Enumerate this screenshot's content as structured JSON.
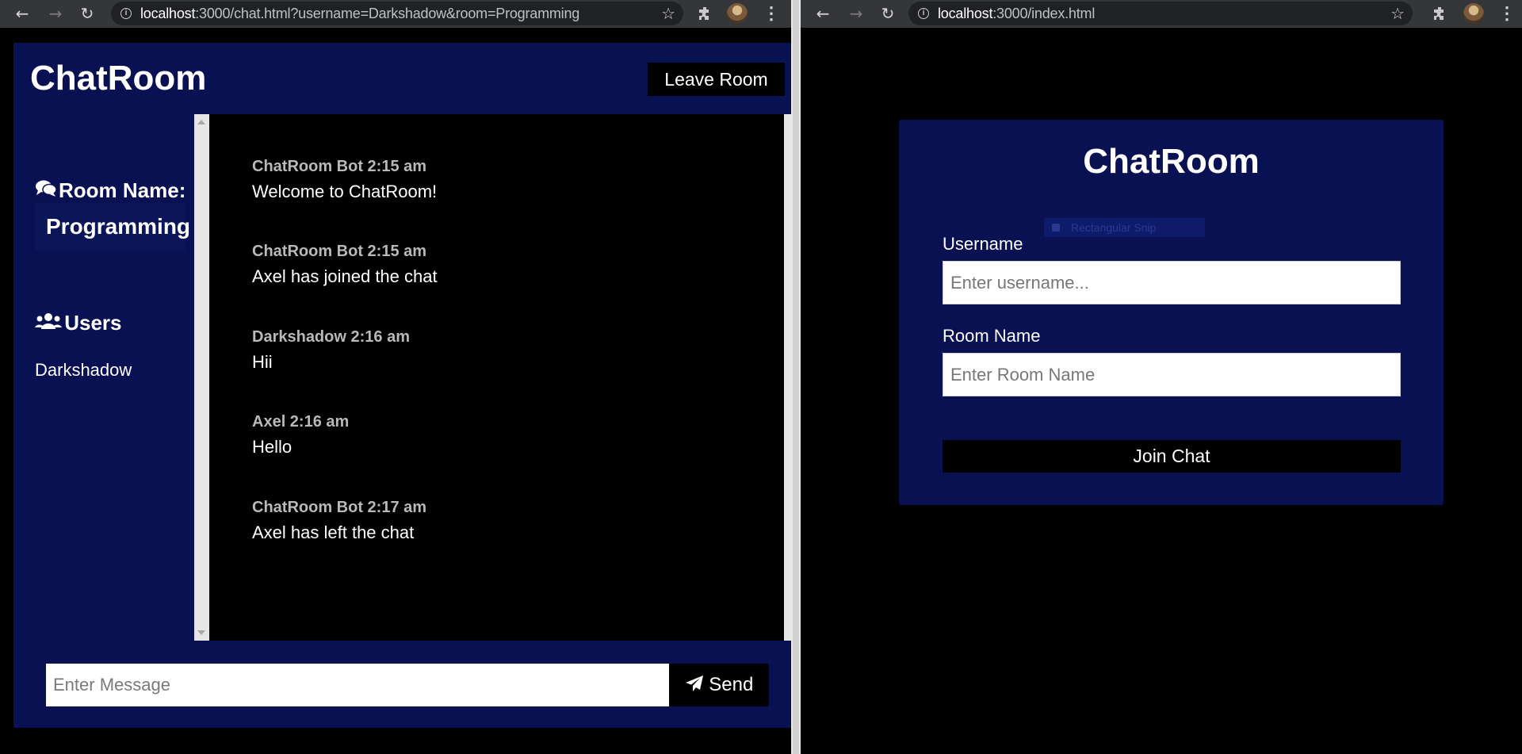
{
  "left_window": {
    "url_host": "localhost",
    "url_rest": ":3000/chat.html?username=Darkshadow&room=Programming",
    "app_title": "ChatRoom",
    "leave_button": "Leave Room",
    "room_heading": "Room Name:",
    "room_name": "Programming",
    "users_heading": "Users",
    "users": [
      "Darkshadow"
    ],
    "messages": [
      {
        "meta": "ChatRoom Bot 2:15 am",
        "text": "Welcome to ChatRoom!"
      },
      {
        "meta": "ChatRoom Bot 2:15 am",
        "text": "Axel has joined the chat"
      },
      {
        "meta": "Darkshadow 2:16 am",
        "text": "Hii"
      },
      {
        "meta": "Axel 2:16 am",
        "text": "Hello"
      },
      {
        "meta": "ChatRoom Bot 2:17 am",
        "text": "Axel has left the chat"
      }
    ],
    "message_placeholder": "Enter Message",
    "send_button": "Send"
  },
  "right_window": {
    "url_host": "localhost",
    "url_rest": ":3000/index.html",
    "app_title": "ChatRoom",
    "snip_overlay_text": "Rectangular Snip",
    "username_label": "Username",
    "username_placeholder": "Enter username...",
    "room_label": "Room Name",
    "room_placeholder": "Enter Room Name",
    "join_button": "Join Chat"
  },
  "colors": {
    "panel_navy": "#091153",
    "page_black": "#000000",
    "meta_gray": "#b9b9b9"
  },
  "icons": {
    "room_heading_icon": "comments-icon",
    "users_heading_icon": "users-icon",
    "send_icon": "paper-plane-icon"
  }
}
